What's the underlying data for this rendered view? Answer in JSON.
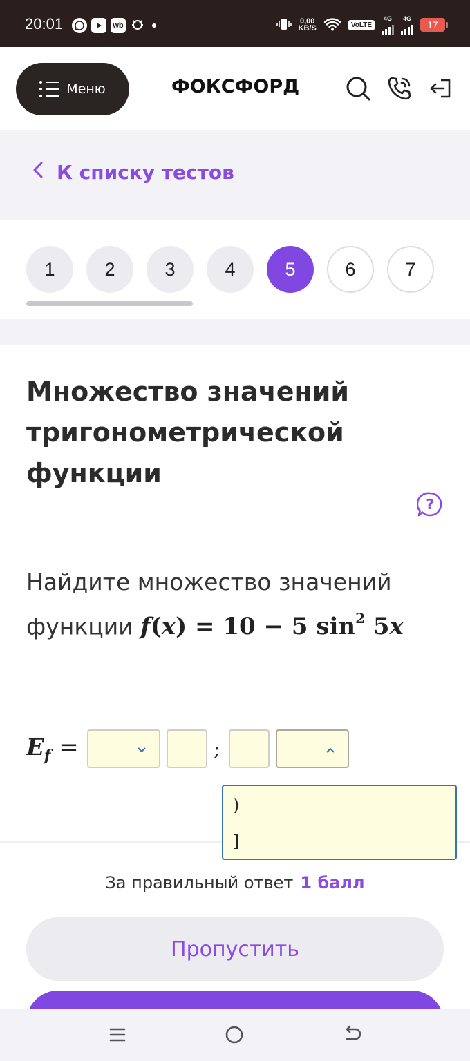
{
  "status_bar": {
    "time": "20:01",
    "app_icons": [
      "whatsapp-icon",
      "youtube-icon",
      "wb-icon",
      "bug-icon"
    ],
    "wb_label": "wb",
    "speed": "0,00",
    "speed_unit": "KB/S",
    "volte": "VoLTE",
    "network": "4G",
    "battery": "17"
  },
  "header": {
    "menu_label": "Меню",
    "logo": "ФОКСФОРД",
    "icons": [
      "search-icon",
      "phone-icon",
      "login-icon"
    ]
  },
  "back_link": {
    "label": "К списку тестов"
  },
  "question_nav": {
    "items": [
      {
        "label": "1",
        "state": "done"
      },
      {
        "label": "2",
        "state": "done"
      },
      {
        "label": "3",
        "state": "done"
      },
      {
        "label": "4",
        "state": "done"
      },
      {
        "label": "5",
        "state": "active"
      },
      {
        "label": "6",
        "state": "future"
      },
      {
        "label": "7",
        "state": "future"
      }
    ],
    "progress_fraction": 0.39
  },
  "question": {
    "title": "Множество значений тригонометрической функции",
    "text_line1": "Найдите множество значений",
    "text_line2": "функции",
    "formula": {
      "f": "f",
      "open": "(",
      "x": "x",
      "close": ")",
      "eq": " = 10 − 5 ",
      "sin": "sin",
      "exp": "2",
      "tail_num": " 5",
      "tail_x": "x"
    }
  },
  "answer": {
    "label_main": "E",
    "label_sub": "f",
    "label_eq": "=",
    "separator": ";",
    "dropdown_options": [
      ")",
      "]"
    ]
  },
  "footer": {
    "score_label": "За правильный ответ",
    "score_value": "1 балл",
    "skip_label": "Пропустить"
  },
  "colors": {
    "accent": "#8048e0",
    "dark": "#2a2522",
    "answer_bg": "#fefde0",
    "focus_border": "#3573b8"
  }
}
